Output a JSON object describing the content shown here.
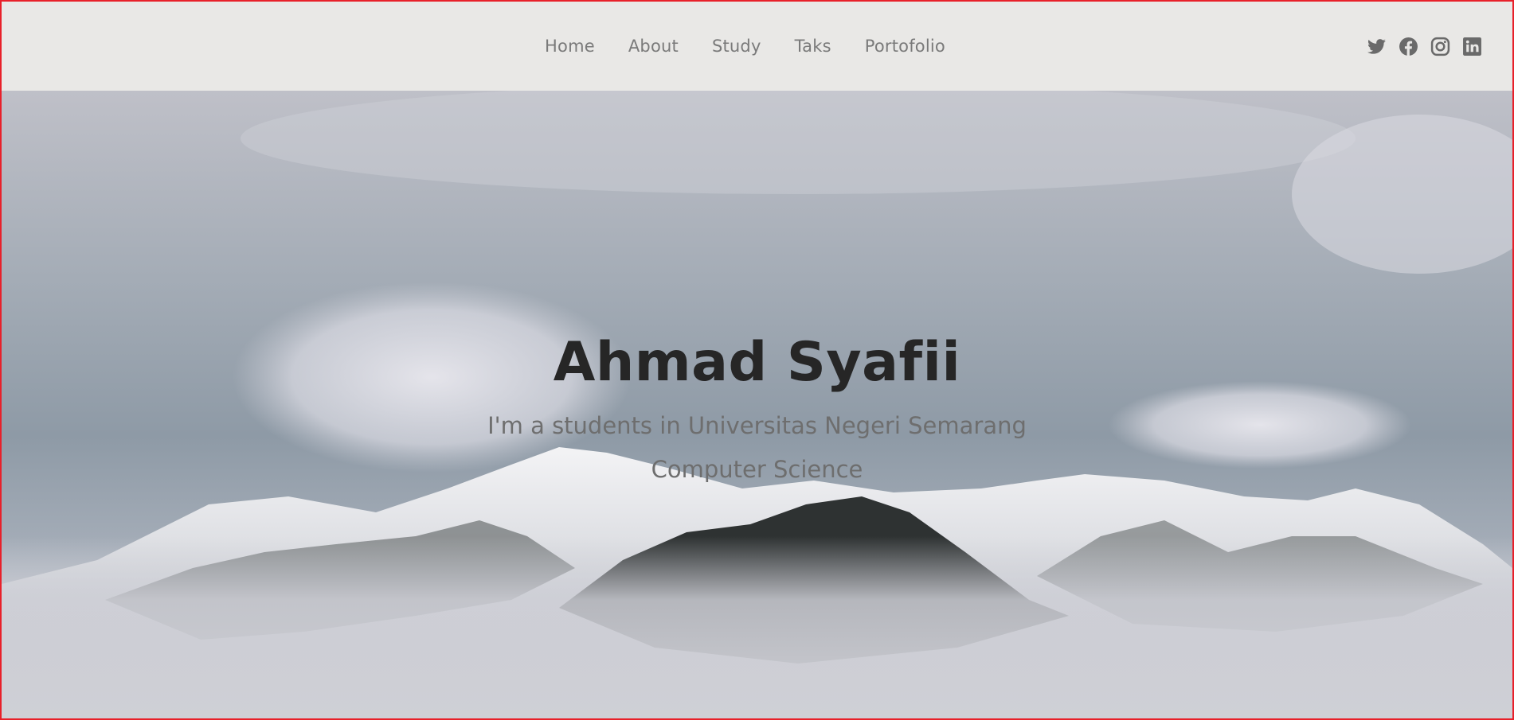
{
  "nav": {
    "items": [
      {
        "label": "Home"
      },
      {
        "label": "About"
      },
      {
        "label": "Study"
      },
      {
        "label": "Taks"
      },
      {
        "label": "Portofolio"
      }
    ]
  },
  "social": {
    "icons": [
      "twitter-icon",
      "facebook-icon",
      "instagram-icon",
      "linkedin-icon"
    ],
    "color": "#6a6a6a"
  },
  "hero": {
    "title": "Ahmad Syafii",
    "subtitle": "I'm a students in Universitas Negeri Semarang Computer Science"
  },
  "colors": {
    "navbar_bg": "#e9e8e6",
    "border": "#e8202a",
    "title": "#262626",
    "subtitle": "#6e6e6e",
    "nav_text": "#7a7a7a"
  }
}
